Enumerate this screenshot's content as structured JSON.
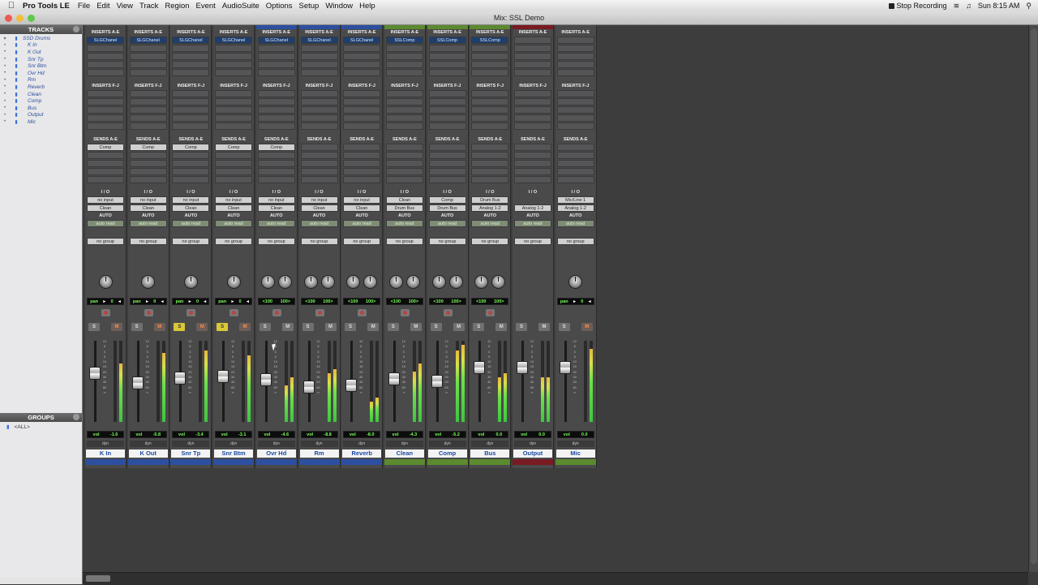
{
  "menubar": {
    "app_name": "Pro Tools LE",
    "items": [
      "File",
      "Edit",
      "View",
      "Track",
      "Region",
      "Event",
      "AudioSuite",
      "Options",
      "Setup",
      "Window",
      "Help"
    ],
    "stop_recording": "Stop Recording",
    "clock": "Sun 8:15 AM"
  },
  "window": {
    "title": "Mix: SSL Demo"
  },
  "tracks_panel": {
    "title": "TRACKS",
    "items": [
      "SSD Drums",
      "K In",
      "K Out",
      "Snr Tp",
      "Snr Btm",
      "Ovr Hd",
      "Rm",
      "Reverb",
      "Clean",
      "Comp",
      "Bus",
      "Output",
      "Mic"
    ]
  },
  "groups_panel": {
    "title": "GROUPS",
    "items": [
      "<ALL>"
    ]
  },
  "labels": {
    "inserts_ae": "INSERTS A-E",
    "inserts_fj": "INSERTS F-J",
    "sends_ae": "SENDS A-E",
    "io": "I / O",
    "auto": "AUTO",
    "pan": "pan",
    "vol": "vol",
    "dyn": "dyn",
    "solo": "S",
    "mute": "M"
  },
  "channels": [
    {
      "name": "K In",
      "insert": "SLGChanel",
      "send": "Comp",
      "input": "no input",
      "output": "Clean",
      "auto": "auto read",
      "group": "no group",
      "pan": [
        "0"
      ],
      "vol": "-1.6",
      "solo_on": false,
      "meters": [
        0.0,
        0.72
      ],
      "fader": 0.62,
      "top": "#4a4a4b",
      "bottom": "#2c4fa0"
    },
    {
      "name": "K Out",
      "insert": "SLGChanel",
      "send": "Comp",
      "input": "no input",
      "output": "Clean",
      "auto": "auto read",
      "group": "no group",
      "pan": [
        "0"
      ],
      "vol": "-5.8",
      "solo_on": false,
      "meters": [
        0.0,
        0.85
      ],
      "fader": 0.48,
      "top": "#4a4a4b",
      "bottom": "#2c4fa0"
    },
    {
      "name": "Snr Tp",
      "insert": "SLGChanel",
      "send": "Comp",
      "input": "no input",
      "output": "Clean",
      "auto": "auto read",
      "group": "no group",
      "pan": [
        "0"
      ],
      "vol": "-3.4",
      "solo_on": true,
      "meters": [
        0.0,
        0.88
      ],
      "fader": 0.55,
      "top": "#4a4a4b",
      "bottom": "#2c4fa0"
    },
    {
      "name": "Snr Btm",
      "insert": "SLGChanel",
      "send": "Comp",
      "input": "no input",
      "output": "Clean",
      "auto": "auto read",
      "group": "no group",
      "pan": [
        "0"
      ],
      "vol": "-3.1",
      "solo_on": true,
      "meters": [
        0.0,
        0.82
      ],
      "fader": 0.57,
      "top": "#4a4a4b",
      "bottom": "#2c4fa0"
    },
    {
      "name": "Ovr Hd",
      "insert": "SLGChanel",
      "send": "Comp",
      "input": "no input",
      "output": "Clean",
      "auto": "auto read",
      "group": "no group",
      "pan": [
        "<100",
        "100>"
      ],
      "vol": "-4.6",
      "solo_on": false,
      "meters": [
        0.45,
        0.55
      ],
      "fader": 0.52,
      "top": "#2c4fa0",
      "bottom": "#2c4fa0"
    },
    {
      "name": "Rm",
      "insert": "SLGChanel",
      "send": "",
      "input": "no input",
      "output": "Clean",
      "auto": "auto read",
      "group": "no group",
      "pan": [
        "<100",
        "100>"
      ],
      "vol": "-8.8",
      "solo_on": false,
      "meters": [
        0.6,
        0.65
      ],
      "fader": 0.42,
      "top": "#2c4fa0",
      "bottom": "#2c4fa0"
    },
    {
      "name": "Reverb",
      "insert": "SLGChanel",
      "send": "",
      "input": "no input",
      "output": "Clean",
      "auto": "auto read",
      "group": "no group",
      "pan": [
        "<100",
        "100>"
      ],
      "vol": "-8.0",
      "solo_on": false,
      "meters": [
        0.25,
        0.3
      ],
      "fader": 0.44,
      "top": "#2c4fa0",
      "bottom": "#2c4fa0"
    },
    {
      "name": "Clean",
      "insert": "SSLComp",
      "send": "",
      "input": "Clean",
      "output": "Drum Bus",
      "auto": "auto read",
      "group": "no group",
      "pan": [
        "<100",
        "100>"
      ],
      "vol": "-4.3",
      "solo_on": false,
      "meters": [
        0.62,
        0.72
      ],
      "fader": 0.53,
      "top": "#5b8a2f",
      "bottom": "#5b8a2f"
    },
    {
      "name": "Comp",
      "insert": "SSLComp",
      "send": "",
      "input": "Comp",
      "output": "Drum Bus",
      "auto": "auto read",
      "group": "no group",
      "pan": [
        "<100",
        "100>"
      ],
      "vol": "-5.2",
      "solo_on": false,
      "meters": [
        0.88,
        0.95
      ],
      "fader": 0.5,
      "top": "#5b8a2f",
      "bottom": "#5b8a2f"
    },
    {
      "name": "Bus",
      "insert": "SSLComp",
      "send": "",
      "input": "Drum Bus",
      "output": "Analog 1-2",
      "auto": "auto read",
      "group": "no group",
      "pan": [
        "<100",
        "100>"
      ],
      "vol": "0.0",
      "solo_on": false,
      "meters": [
        0.55,
        0.6
      ],
      "fader": 0.7,
      "top": "#5b8a2f",
      "bottom": "#5b8a2f"
    },
    {
      "name": "Output",
      "insert": "",
      "send": "",
      "input": "",
      "output": "Analog 1-2",
      "auto": "auto read",
      "group": "no group",
      "pan": [],
      "vol": "0.0",
      "solo_on": false,
      "meters": [
        0.55,
        0.55
      ],
      "fader": 0.7,
      "top": "#7a1a22",
      "bottom": "#7a1a22"
    },
    {
      "name": "Mic",
      "insert": "",
      "send": "",
      "input": "Mic/Line 1",
      "output": "Analog 1-2",
      "auto": "auto read",
      "group": "no group",
      "pan": [
        "0"
      ],
      "vol": "0.0",
      "solo_on": false,
      "meters": [
        0.0,
        0.9
      ],
      "fader": 0.7,
      "top": "#4a4a4b",
      "bottom": "#5b8a2f"
    }
  ],
  "colors": {
    "blue": "#2c4fa0",
    "green": "#5b8a2f",
    "red": "#7a1a22",
    "meter": "#4fd04a",
    "solo": "#d8c838"
  }
}
